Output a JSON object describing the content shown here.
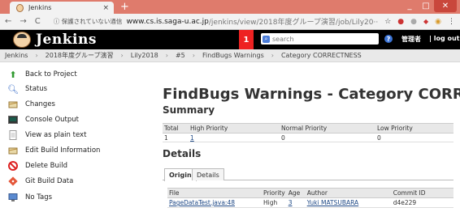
{
  "browser": {
    "tab_title": "Jenkins",
    "tab_close": "×",
    "new_tab": "+",
    "win_min": "_",
    "win_max": "□",
    "win_close": "✕",
    "nav_back": "←",
    "nav_forward": "→",
    "nav_reload": "C",
    "security_text": "ⓘ 保護されていない通信",
    "url_host": "www.cs.is.saga-u.ac.jp",
    "url_path": "/jenkins/view/2018年度グループ演習/job/Lily20···",
    "star": "☆",
    "menu": "⋮"
  },
  "header": {
    "title": "Jenkins",
    "notifications": "1",
    "search_placeholder": "search",
    "help": "?",
    "user": "管理者",
    "logout": "| log out"
  },
  "breadcrumb": [
    "Jenkins",
    "2018年度グループ演習",
    "Lily2018",
    "#5",
    "FindBugs Warnings",
    "Category CORRECTNESS"
  ],
  "sidebar": {
    "items": [
      {
        "label": "Back to Project",
        "icon": "up-arrow-icon"
      },
      {
        "label": "Status",
        "icon": "magnifier-icon"
      },
      {
        "label": "Changes",
        "icon": "notepad-icon"
      },
      {
        "label": "Console Output",
        "icon": "terminal-icon"
      },
      {
        "label": "View as plain text",
        "icon": "document-icon"
      },
      {
        "label": "Edit Build Information",
        "icon": "notepad-icon"
      },
      {
        "label": "Delete Build",
        "icon": "no-entry-icon"
      },
      {
        "label": "Git Build Data",
        "icon": "git-icon"
      },
      {
        "label": "No Tags",
        "icon": "computer-icon"
      }
    ]
  },
  "main": {
    "heading": "FindBugs Warnings - Category CORRECTNESS",
    "summary_heading": "Summary",
    "summary": {
      "headers": [
        "Total",
        "High Priority",
        "Normal Priority",
        "Low Priority"
      ],
      "values": [
        "1",
        "1",
        "0",
        "0"
      ]
    },
    "details_heading": "Details",
    "tabs": [
      "Origin",
      "Details"
    ],
    "details": {
      "headers": [
        "File",
        "Priority",
        "Age",
        "Author",
        "Commit ID"
      ],
      "rows": [
        {
          "file": "PageDataTest.java:48",
          "priority": "High",
          "age": "3",
          "author": "Yuki MATSUBARA",
          "commit": "d4e229"
        }
      ]
    }
  }
}
